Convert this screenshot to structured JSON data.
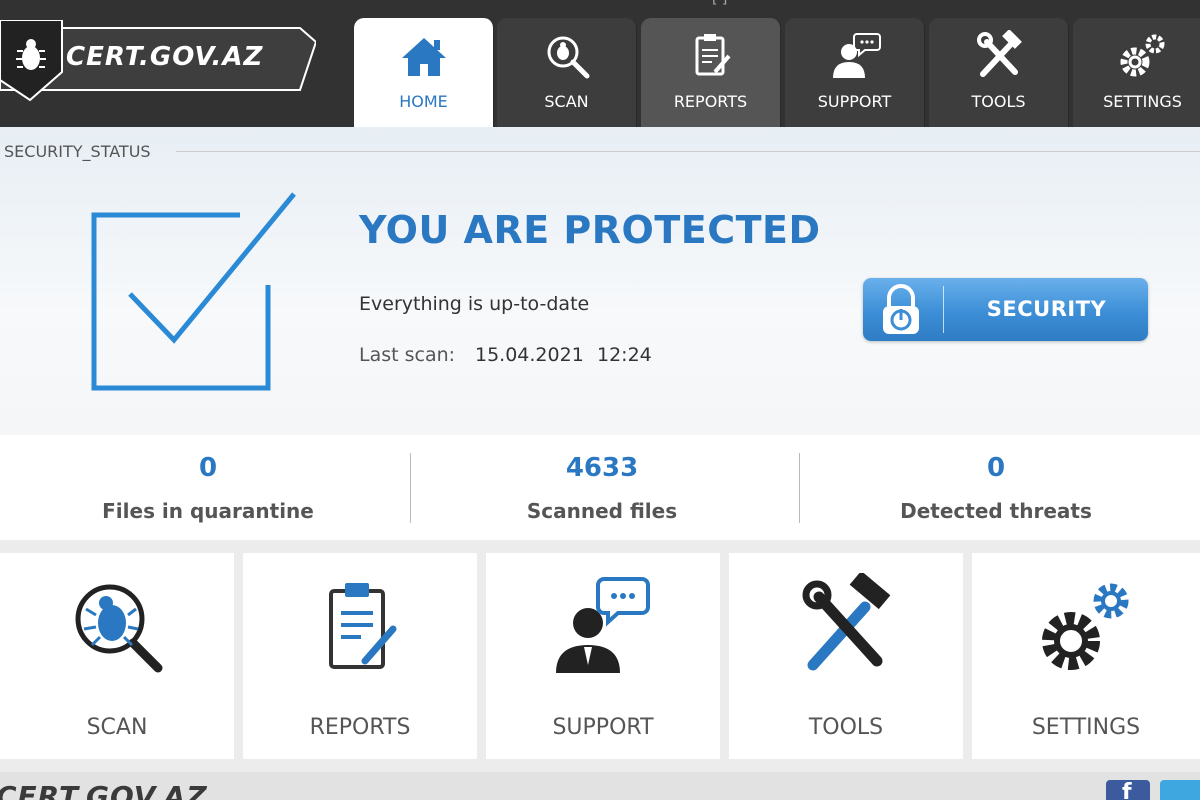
{
  "app": {
    "logo_text": "CERT.GOV.AZ",
    "footer_logo_text": "CERT.GOV.AZ",
    "title_hint": "[ ]"
  },
  "nav": {
    "tabs": [
      {
        "label": "HOME",
        "icon": "home-icon",
        "active": true
      },
      {
        "label": "SCAN",
        "icon": "magnifier-bug-icon",
        "active": false
      },
      {
        "label": "REPORTS",
        "icon": "clipboard-icon",
        "active": false
      },
      {
        "label": "SUPPORT",
        "icon": "support-agent-icon",
        "active": false
      },
      {
        "label": "TOOLS",
        "icon": "tools-icon",
        "active": false
      },
      {
        "label": "SETTINGS",
        "icon": "gears-icon",
        "active": false
      }
    ]
  },
  "security_status": {
    "section_title": "SECURITY_STATUS",
    "headline": "YOU ARE PROTECTED",
    "subtitle": "Everything is up-to-date",
    "last_scan_label": "Last scan:",
    "last_scan_date": "15.04.2021",
    "last_scan_time": "12:24",
    "button_label": "SECURITY",
    "button_icon": "lock-power-icon"
  },
  "stats": [
    {
      "value": "0",
      "label": "Files in quarantine"
    },
    {
      "value": "4633",
      "label": "Scanned files"
    },
    {
      "value": "0",
      "label": "Detected threats"
    }
  ],
  "tiles": [
    {
      "label": "SCAN",
      "icon": "magnifier-bug-icon"
    },
    {
      "label": "REPORTS",
      "icon": "clipboard-icon"
    },
    {
      "label": "SUPPORT",
      "icon": "support-agent-icon"
    },
    {
      "label": "TOOLS",
      "icon": "tools-icon"
    },
    {
      "label": "SETTINGS",
      "icon": "gears-icon"
    }
  ],
  "colors": {
    "accent": "#2b78c2",
    "topbar": "#323232",
    "button_blue": "#3c8ed6",
    "facebook": "#3b5b9e",
    "twitter": "#3fa7e0"
  }
}
